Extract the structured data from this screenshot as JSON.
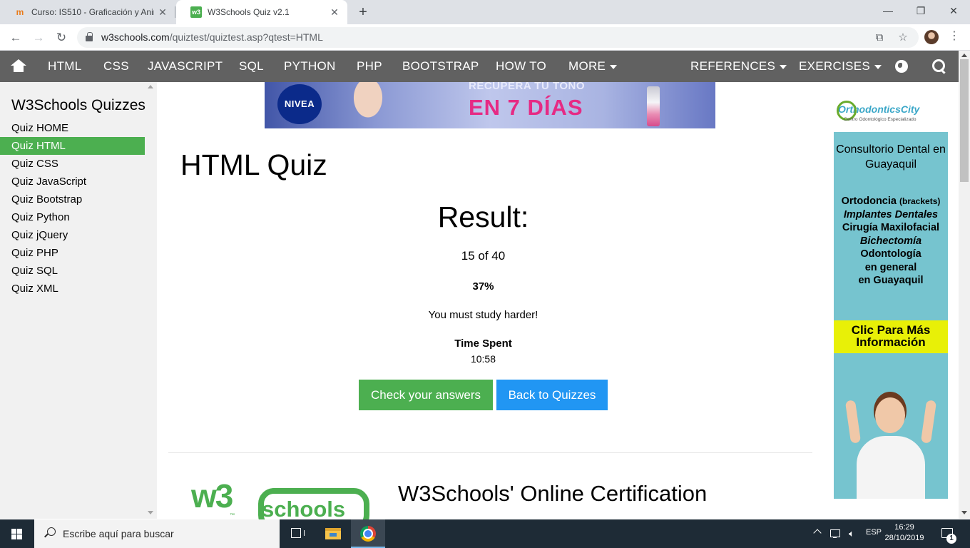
{
  "browser": {
    "tabs": [
      {
        "title": "Curso: IS510 - Graficación y Anim",
        "close": "✕"
      },
      {
        "title": "W3Schools Quiz v2.1",
        "close": "✕"
      }
    ],
    "new_tab": "+",
    "window_controls": {
      "minimize": "—",
      "maximize": "❐",
      "close": "✕"
    },
    "url_host": "w3schools.com",
    "url_path": "/quiztest/quiztest.asp?qtest=HTML"
  },
  "topnav": {
    "items": [
      "HTML",
      "CSS",
      "JAVASCRIPT",
      "SQL",
      "PYTHON",
      "PHP",
      "BOOTSTRAP",
      "HOW TO",
      "MORE"
    ],
    "references": "REFERENCES",
    "exercises": "EXERCISES"
  },
  "sidebar": {
    "title": "W3Schools Quizzes",
    "items": [
      "Quiz HOME",
      "Quiz HTML",
      "Quiz CSS",
      "Quiz JavaScript",
      "Quiz Bootstrap",
      "Quiz Python",
      "Quiz jQuery",
      "Quiz PHP",
      "Quiz SQL",
      "Quiz XML"
    ],
    "active_index": 1
  },
  "banner": {
    "brand": "NIVEA",
    "line1": "RECUPERA TU TONO",
    "line2": "EN 7 DÍAS"
  },
  "main": {
    "title": "HTML Quiz",
    "result_heading": "Result:",
    "score": "15 of 40",
    "percent": "37%",
    "message": "You must study harder!",
    "time_label": "Time Spent",
    "time_value": "10:58",
    "check_button": "Check your answers",
    "back_button": "Back to Quizzes",
    "cert_heading": "W3Schools' Online Certification",
    "logo_text": "schools",
    "logo_mark": "w3",
    "logo_tm": "™"
  },
  "ad": {
    "logo_name": "OrthodonticsCity",
    "logo_sub": "Centro Odontológico Especializado",
    "headline": "Consultorio Dental en Guayaquil",
    "services": [
      {
        "text": "Ortodoncia ",
        "extra": "(brackets)"
      },
      {
        "text": "Implantes Dentales"
      },
      {
        "text": "Cirugía Maxilofacial"
      },
      {
        "text": "Bichectomía"
      },
      {
        "text": "Odontología"
      },
      {
        "text": "en general"
      },
      {
        "text": "en Guayaquil"
      }
    ],
    "cta": "Clic Para Más Información"
  },
  "taskbar": {
    "search_placeholder": "Escribe aquí para buscar",
    "language": "ESP",
    "time": "16:29",
    "date": "28/10/2019",
    "notifications": "1"
  },
  "colors": {
    "nav_bg": "#616161",
    "w3_green": "#4caf50",
    "w3_blue": "#2196f3",
    "sidebar_bg": "#f1f1f1",
    "ad_bg": "#76c4cf",
    "ad_cta_bg": "#e8f007"
  },
  "icons": [
    "home-icon",
    "globe-icon",
    "search-icon",
    "lock-icon",
    "translate-icon",
    "star-icon",
    "back-arrow-icon",
    "forward-arrow-icon",
    "reload-icon",
    "windows-start-icon",
    "task-view-icon",
    "file-explorer-icon",
    "chrome-icon"
  ]
}
